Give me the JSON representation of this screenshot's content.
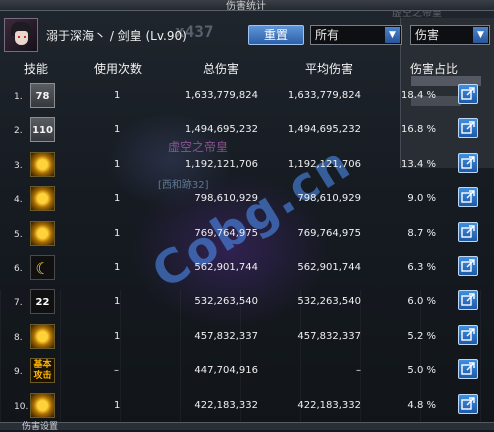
{
  "window": {
    "title": "伤害统计"
  },
  "player": {
    "name": "溺于深海丶 / 剑皇 (Lv.90)"
  },
  "controls": {
    "reset_label": "重置",
    "target_select": "所有",
    "type_select": "伤害",
    "dropdown_glyph": "▼"
  },
  "table": {
    "headers": {
      "skill": "技能",
      "uses": "使用次数",
      "total": "总伤害",
      "avg": "平均伤害",
      "pct": "伤害占比"
    },
    "rows": [
      {
        "num": "1.",
        "icon": "gray-skill-78-icon",
        "icon_text": "78",
        "uses": "1",
        "total": "1,633,779,824",
        "avg": "1,633,779,824",
        "pct": "18.4 %"
      },
      {
        "num": "2.",
        "icon": "gray-skill-110-icon",
        "icon_text": "110",
        "uses": "1",
        "total": "1,494,695,232",
        "avg": "1,494,695,232",
        "pct": "16.8 %"
      },
      {
        "num": "3.",
        "icon": "golden-burst-skill-icon",
        "icon_text": "",
        "uses": "1",
        "total": "1,192,121,706",
        "avg": "1,192,121,706",
        "pct": "13.4 %"
      },
      {
        "num": "4.",
        "icon": "golden-swords-skill-icon",
        "icon_text": "",
        "uses": "1",
        "total": "798,610,929",
        "avg": "798,610,929",
        "pct": "9.0 %"
      },
      {
        "num": "5.",
        "icon": "golden-slash-skill-icon",
        "icon_text": "",
        "uses": "1",
        "total": "769,764,975",
        "avg": "769,764,975",
        "pct": "8.7 %"
      },
      {
        "num": "6.",
        "icon": "crescent-moon-skill-icon",
        "icon_text": "",
        "uses": "1",
        "total": "562,901,744",
        "avg": "562,901,744",
        "pct": "6.3 %"
      },
      {
        "num": "7.",
        "icon": "dark-skill-22-icon",
        "icon_text": "22",
        "uses": "1",
        "total": "532,263,540",
        "avg": "532,263,540",
        "pct": "6.0 %"
      },
      {
        "num": "8.",
        "icon": "golden-star-skill-icon",
        "icon_text": "",
        "uses": "1",
        "total": "457,832,337",
        "avg": "457,832,337",
        "pct": "5.2 %"
      },
      {
        "num": "9.",
        "icon": "basic-attack-icon",
        "icon_text": "基本攻击",
        "uses": "–",
        "total": "447,704,916",
        "avg": "–",
        "pct": "5.0 %"
      },
      {
        "num": "10.",
        "icon": "golden-wave-skill-icon",
        "icon_text": "",
        "uses": "1",
        "total": "422,183,332",
        "avg": "422,183,332",
        "pct": "4.8 %"
      }
    ]
  },
  "background": {
    "rank_text": "x437",
    "ghost_name": "虚空之帝皇",
    "ghost_guild": "[西和跡32]",
    "ghost_top": "虚空之帝皇",
    "watermark": "Cobg.cn",
    "footer_text": "伤害设置"
  },
  "colors": {
    "accent": "#2d5fa8",
    "button_border": "#9cc4f0",
    "header_text": "#f2f2f2"
  }
}
